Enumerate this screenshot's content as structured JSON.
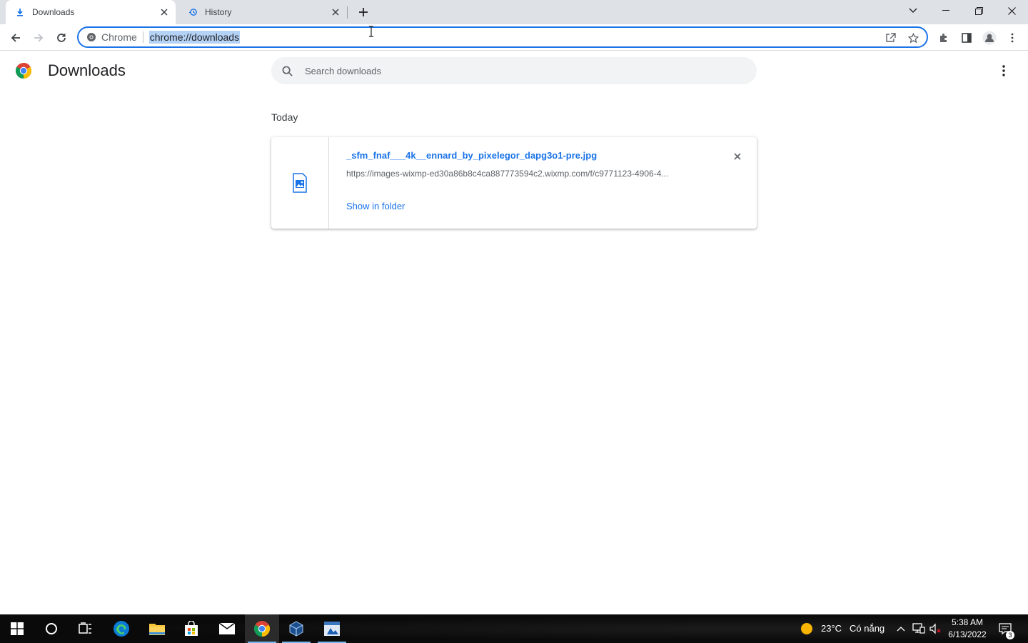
{
  "browser": {
    "tabs": [
      {
        "title": "Downloads",
        "active": true,
        "icon": "download-icon"
      },
      {
        "title": "History",
        "active": false,
        "icon": "history-icon"
      }
    ],
    "omnibox": {
      "chip_label": "Chrome",
      "url": "chrome://downloads"
    }
  },
  "downloads_page": {
    "title": "Downloads",
    "search_placeholder": "Search downloads",
    "date_heading": "Today",
    "items": [
      {
        "filename": "_sfm_fnaf___4k__ennard_by_pixelegor_dapg3o1-pre.jpg",
        "url": "https://images-wixmp-ed30a86b8c4ca887773594c2.wixmp.com/f/c9771123-4906-4...",
        "action_label": "Show in folder",
        "icon": "image-file-icon"
      }
    ]
  },
  "taskbar": {
    "weather": {
      "temperature": "23°C",
      "condition": "Có nắng"
    },
    "clock": {
      "time": "5:38 AM",
      "date": "6/13/2022"
    },
    "notification_count": "3"
  },
  "colors": {
    "accent": "#1a73e8",
    "tabstrip": "#dee1e6",
    "taskbar": "#0a0a0a"
  }
}
